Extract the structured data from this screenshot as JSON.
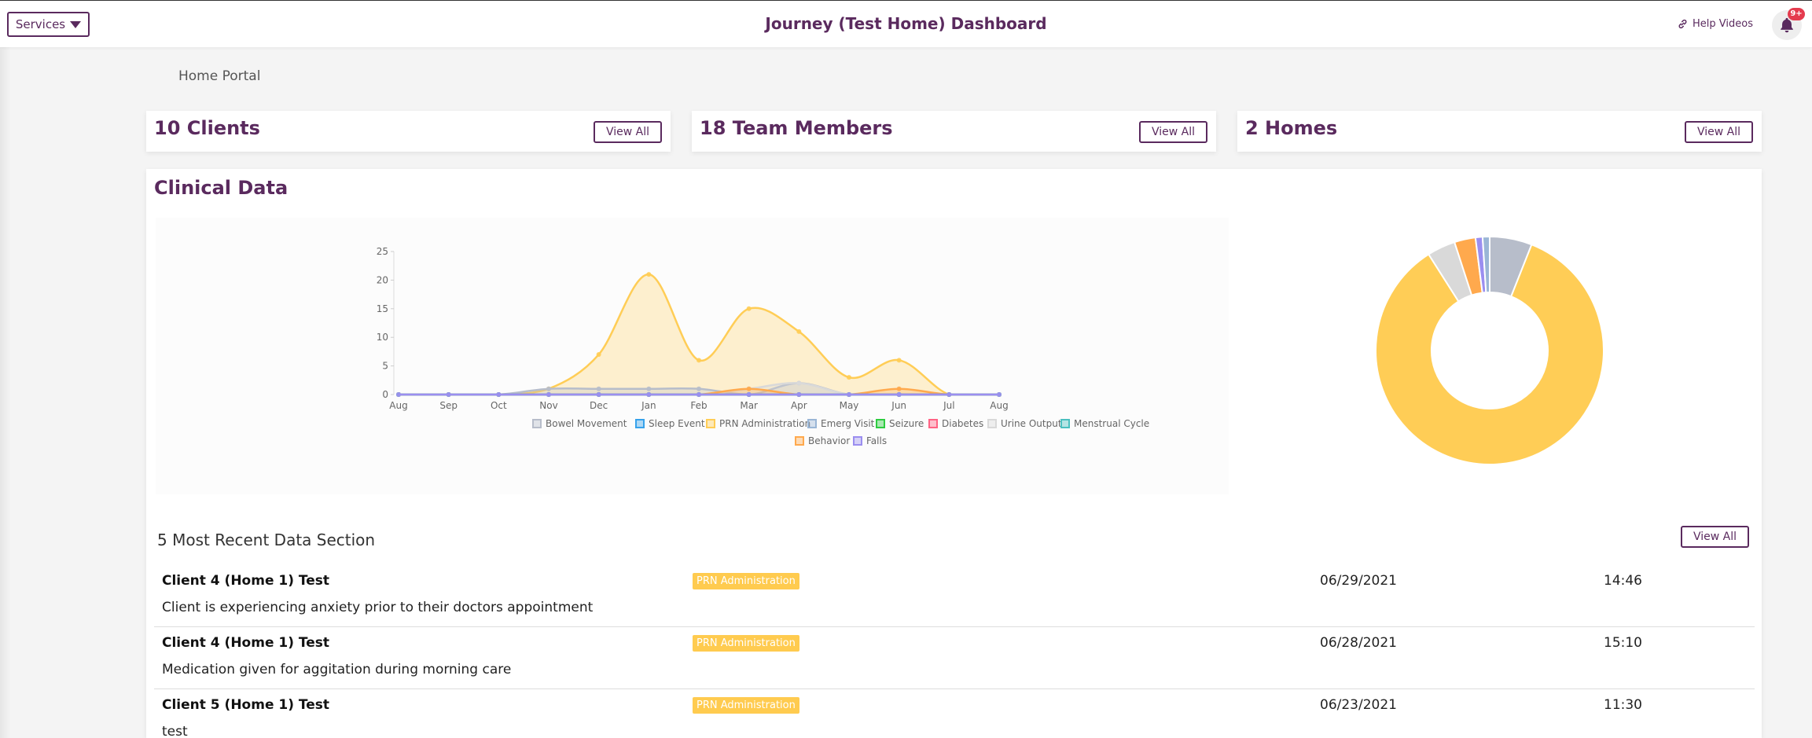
{
  "header": {
    "services_label": "Services",
    "title": "Journey (Test Home) Dashboard",
    "help_label": "Help Videos",
    "notification_badge": "9+"
  },
  "breadcrumb": "Home Portal",
  "summary_cards": [
    {
      "title": "10 Clients",
      "button": "View All"
    },
    {
      "title": "18 Team Members",
      "button": "View All"
    },
    {
      "title": "2 Homes",
      "button": "View All"
    }
  ],
  "clinical": {
    "title": "Clinical Data"
  },
  "colors": {
    "brand": "#5a2a5e",
    "prn": "#ffcb4f",
    "badge": "#e43b4e"
  },
  "chart_data": [
    {
      "type": "area",
      "x": [
        "Aug",
        "Sep",
        "Oct",
        "Nov",
        "Dec",
        "Jan",
        "Feb",
        "Mar",
        "Apr",
        "May",
        "Jun",
        "Jul",
        "Aug"
      ],
      "ylim": [
        0,
        25
      ],
      "yticks": [
        0,
        5,
        10,
        15,
        20,
        25
      ],
      "series": [
        {
          "name": "Bowel Movement",
          "color": "#b7bdca",
          "values": [
            0,
            0,
            0,
            1,
            1,
            1,
            1,
            0,
            2,
            0,
            0,
            0,
            0
          ]
        },
        {
          "name": "Sleep Event",
          "color": "#36a2eb",
          "values": [
            0,
            0,
            0,
            0,
            0,
            0,
            0,
            0,
            0,
            0,
            0,
            0,
            0
          ]
        },
        {
          "name": "PRN Administration",
          "color": "#ffcd56",
          "values": [
            0,
            0,
            0,
            1,
            7,
            21,
            6,
            15,
            11,
            3,
            6,
            0,
            0
          ]
        },
        {
          "name": "Emerg Visit",
          "color": "#9ab6d6",
          "values": [
            0,
            0,
            0,
            0,
            0,
            0,
            0,
            0,
            0,
            0,
            0,
            0,
            0
          ]
        },
        {
          "name": "Seizure",
          "color": "#2ecc40",
          "values": [
            0,
            0,
            0,
            0,
            0,
            0,
            0,
            0,
            0,
            0,
            0,
            0,
            0
          ]
        },
        {
          "name": "Diabetes",
          "color": "#ff6384",
          "values": [
            0,
            0,
            0,
            0,
            0,
            0,
            0,
            0,
            0,
            0,
            0,
            0,
            0
          ]
        },
        {
          "name": "Urine Output",
          "color": "#d9d9d9",
          "values": [
            0,
            0,
            0,
            0,
            0,
            0,
            0,
            1,
            2,
            0,
            0,
            0,
            0
          ]
        },
        {
          "name": "Menstrual Cycle",
          "color": "#4bc0c0",
          "values": [
            0,
            0,
            0,
            0,
            0,
            0,
            0,
            0,
            0,
            0,
            0,
            0,
            0
          ]
        },
        {
          "name": "Behavior",
          "color": "#ffa94d",
          "values": [
            0,
            0,
            0,
            0,
            0,
            0,
            0,
            1,
            0,
            0,
            1,
            0,
            0
          ]
        },
        {
          "name": "Falls",
          "color": "#9b8ef0",
          "values": [
            0,
            0,
            0,
            0,
            0,
            0,
            0,
            0,
            0,
            0,
            0,
            0,
            0
          ]
        }
      ]
    },
    {
      "type": "pie",
      "style": "doughnut",
      "slices": [
        {
          "color": "#b7bdca",
          "value": 6
        },
        {
          "color": "#ffcd56",
          "value": 85
        },
        {
          "color": "#d9d9d9",
          "value": 4
        },
        {
          "color": "#ffa94d",
          "value": 3
        },
        {
          "color": "#9b8ef0",
          "value": 1
        },
        {
          "color": "#9ab6d6",
          "value": 1
        }
      ]
    }
  ],
  "recent": {
    "title": "5 Most Recent Data Section",
    "button": "View All",
    "rows": [
      {
        "client": "Client 4 (Home 1) Test",
        "note": "Client is experiencing anxiety prior to their doctors appointment",
        "tag": "PRN Administration",
        "date": "06/29/2021",
        "time": "14:46"
      },
      {
        "client": "Client 4 (Home 1) Test",
        "note": "Medication given for aggitation during morning care",
        "tag": "PRN Administration",
        "date": "06/28/2021",
        "time": "15:10"
      },
      {
        "client": "Client 5 (Home 1) Test",
        "note": "test",
        "tag": "PRN Administration",
        "date": "06/23/2021",
        "time": "11:30"
      }
    ]
  }
}
